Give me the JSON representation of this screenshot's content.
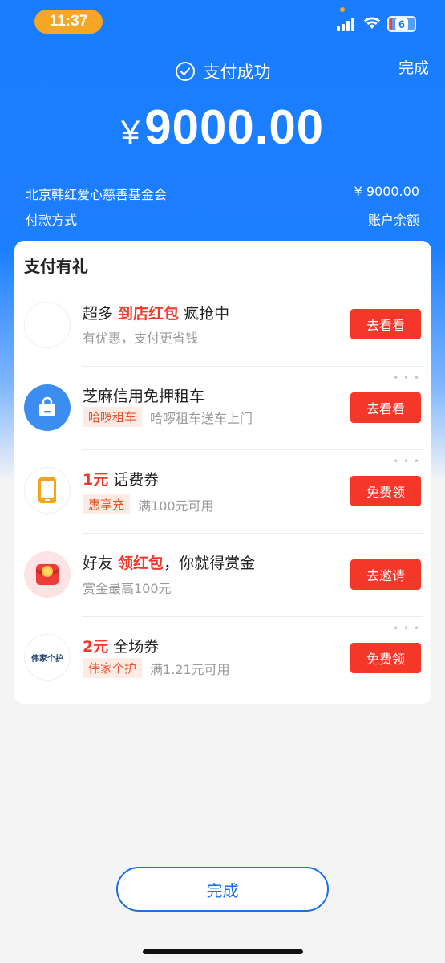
{
  "status_bar": {
    "time": "11:37",
    "battery": "6"
  },
  "header": {
    "status_text": "支付成功",
    "done_label": "完成",
    "currency_symbol": "¥",
    "amount": "9000.00",
    "payee": "北京韩红爱心慈善基金会",
    "payee_amount": "¥ 9000.00",
    "method_label": "付款方式",
    "method_value": "账户余额"
  },
  "rewards": {
    "title": "支付有礼",
    "items": [
      {
        "title_pre": "超多 ",
        "title_red": "到店红包",
        "title_post": " 疯抢中",
        "tag": "",
        "subtitle": "有优惠，支付更省钱",
        "button": "去看看",
        "icon": "blank-logo-icon"
      },
      {
        "title_pre": "芝麻信用免押租车",
        "title_red": "",
        "title_post": "",
        "tag": "哈啰租车",
        "subtitle": "哈啰租车送车上门",
        "button": "去看看",
        "icon": "shopping-bag-icon"
      },
      {
        "title_pre": "",
        "title_red": "1元",
        "title_post": " 话费券",
        "tag": "惠享充",
        "subtitle": "满100元可用",
        "button": "免费领",
        "icon": "phone-icon"
      },
      {
        "title_pre": "好友 ",
        "title_red": "领红包",
        "title_post": "，你就得赏金",
        "tag": "",
        "subtitle": "赏金最高100元",
        "button": "去邀请",
        "icon": "red-envelope-icon"
      },
      {
        "title_pre": "",
        "title_red": "2元",
        "title_post": " 全场券",
        "tag": "伟家个护",
        "subtitle": "满1.21元可用",
        "button": "免费领",
        "icon": "weijia-logo-icon",
        "logo_text": "伟家个护"
      }
    ]
  },
  "footer": {
    "done_label": "完成"
  },
  "colors": {
    "primary_blue": "#1a7cff",
    "accent_red": "#f5372a",
    "time_pill": "#f5a623"
  }
}
